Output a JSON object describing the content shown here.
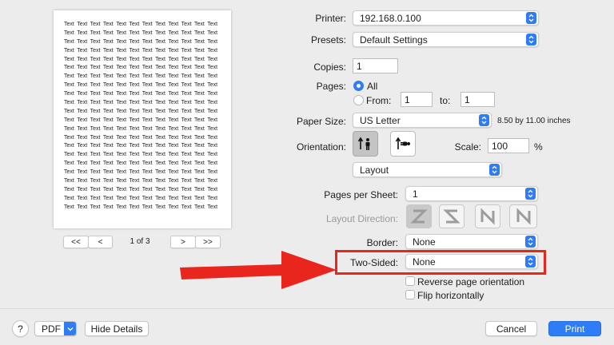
{
  "preview": {
    "word": "Text",
    "columns": 12,
    "rows": 22,
    "page_indicator": "1 of 3",
    "first_label": "<<",
    "prev_label": "<",
    "next_label": ">",
    "last_label": ">>"
  },
  "printer": {
    "label": "Printer:",
    "value": "192.168.0.100"
  },
  "presets": {
    "label": "Presets:",
    "value": "Default Settings"
  },
  "copies": {
    "label": "Copies:",
    "value": "1"
  },
  "pages": {
    "label": "Pages:",
    "all_label": "All",
    "from_label": "From:",
    "from_value": "1",
    "to_label": "to:",
    "to_value": "1"
  },
  "paper_size": {
    "label": "Paper Size:",
    "value": "US Letter",
    "dimensions": "8.50 by 11.00 inches"
  },
  "orientation": {
    "label": "Orientation:"
  },
  "scale": {
    "label": "Scale:",
    "value": "100",
    "unit": "%"
  },
  "section_select": {
    "value": "Layout"
  },
  "pages_per_sheet": {
    "label": "Pages per Sheet:",
    "value": "1"
  },
  "layout_direction": {
    "label": "Layout Direction:"
  },
  "border": {
    "label": "Border:",
    "value": "None"
  },
  "two_sided": {
    "label": "Two-Sided:",
    "value": "None"
  },
  "reverse_orientation": {
    "label": "Reverse page orientation"
  },
  "flip_horizontally": {
    "label": "Flip horizontally"
  },
  "footer": {
    "help_label": "?",
    "pdf_label": "PDF",
    "hide_details_label": "Hide Details",
    "cancel_label": "Cancel",
    "print_label": "Print"
  },
  "colors": {
    "accent": "#2e7cf6",
    "annotation_red": "#e8261d"
  }
}
